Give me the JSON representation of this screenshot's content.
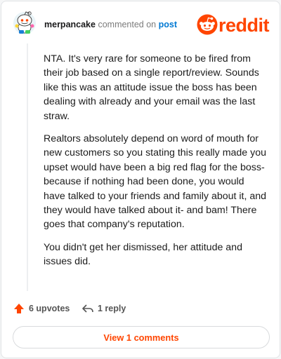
{
  "header": {
    "username": "merpancake",
    "action_text": "commented on",
    "post_link": "post",
    "brand_name": "reddit"
  },
  "comment": {
    "paragraphs": [
      "NTA. It's very rare for someone to be fired from their job based on a single report/review. Sounds like this was an attitude issue the boss has been dealing with already and your email was the last straw.",
      "Realtors absolutely depend on word of mouth for new customers so you stating this really made you upset would have been a big red flag for the boss- because if nothing had been done, you would have talked to your friends and family about it, and they would have talked about it- and bam! There goes that company's reputation.",
      "You didn't get her dismissed, her attitude and issues did."
    ]
  },
  "actions": {
    "upvotes_label": "6 upvotes",
    "reply_label": "1 reply"
  },
  "footer": {
    "view_comments_label": "View 1 comments"
  },
  "colors": {
    "brand": "#ff4500",
    "link": "#0079d3",
    "muted": "#7c7c7c"
  },
  "icons": {
    "avatar": "snoo-avatar-icon",
    "logo": "reddit-logo-icon",
    "upvote": "upvote-arrow-icon",
    "reply": "reply-arrow-icon"
  }
}
